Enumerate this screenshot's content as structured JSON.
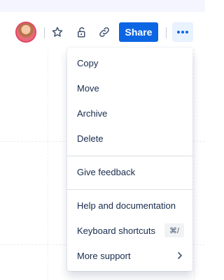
{
  "toolbar": {
    "share_label": "Share",
    "icons": [
      "avatar",
      "star-icon",
      "unlock-icon",
      "link-icon",
      "more-icon"
    ]
  },
  "menu": {
    "copy": "Copy",
    "move": "Move",
    "archive": "Archive",
    "delete": "Delete",
    "feedback": "Give feedback",
    "help": "Help and documentation",
    "shortcuts": "Keyboard shortcuts",
    "shortcuts_key": "⌘/",
    "support": "More support"
  },
  "colors": {
    "accent": "#0c66e4",
    "more_button_bg": "#e9f2ff",
    "text": "#172b4d"
  }
}
